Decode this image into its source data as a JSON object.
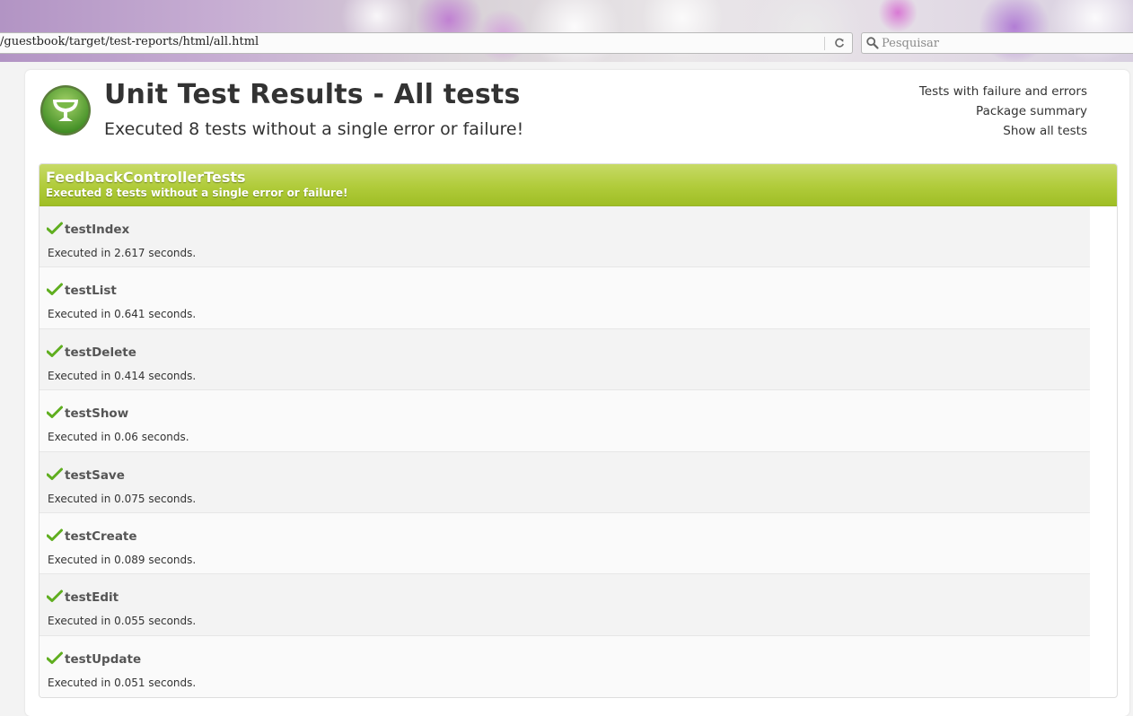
{
  "browser": {
    "url": "/guestbook/target/test-reports/html/all.html",
    "search_placeholder": "Pesquisar",
    "reload_icon": "reload-icon",
    "search_icon": "magnifier-icon"
  },
  "header": {
    "title": "Unit Test Results - All tests",
    "subtitle": "Executed 8 tests without a single error or failure!",
    "logo_icon": "grails-trophy-icon"
  },
  "nav": {
    "items": [
      {
        "label": "Tests with failure and errors"
      },
      {
        "label": "Package summary"
      },
      {
        "label": "Show all tests"
      }
    ]
  },
  "suite": {
    "name": "FeedbackControllerTests",
    "summary": "Executed 8 tests without a single error or failure!",
    "header_color": "#a9c630",
    "tests": [
      {
        "name": "testIndex",
        "time": "Executed in 2.617 seconds.",
        "status": "passed"
      },
      {
        "name": "testList",
        "time": "Executed in 0.641 seconds.",
        "status": "passed"
      },
      {
        "name": "testDelete",
        "time": "Executed in 0.414 seconds.",
        "status": "passed"
      },
      {
        "name": "testShow",
        "time": "Executed in 0.06 seconds.",
        "status": "passed"
      },
      {
        "name": "testSave",
        "time": "Executed in 0.075 seconds.",
        "status": "passed"
      },
      {
        "name": "testCreate",
        "time": "Executed in 0.089 seconds.",
        "status": "passed"
      },
      {
        "name": "testEdit",
        "time": "Executed in 0.055 seconds.",
        "status": "passed"
      },
      {
        "name": "testUpdate",
        "time": "Executed in 0.051 seconds.",
        "status": "passed"
      }
    ]
  }
}
